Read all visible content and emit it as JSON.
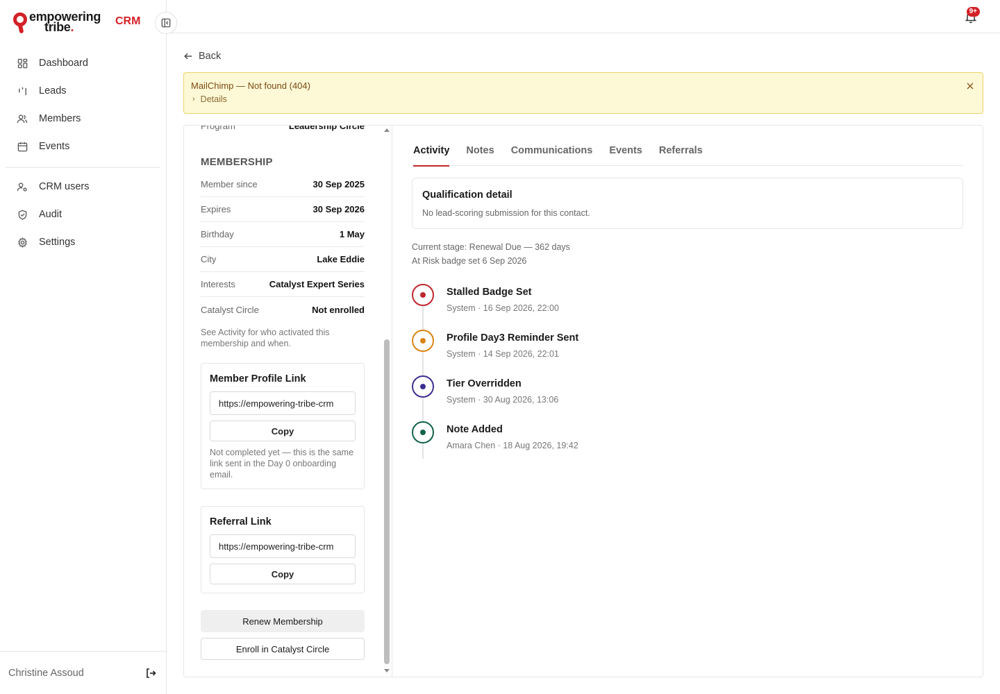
{
  "brand": {
    "line1": "empowering",
    "line2": "tribe",
    "suffix": "CRM"
  },
  "sidebar": {
    "items": [
      {
        "label": "Dashboard",
        "icon": "dashboard-icon"
      },
      {
        "label": "Leads",
        "icon": "leads-icon"
      },
      {
        "label": "Members",
        "icon": "members-icon"
      },
      {
        "label": "Events",
        "icon": "calendar-icon"
      }
    ],
    "admin_items": [
      {
        "label": "CRM users",
        "icon": "user-gear-icon"
      },
      {
        "label": "Audit",
        "icon": "shield-icon"
      },
      {
        "label": "Settings",
        "icon": "gear-icon"
      }
    ],
    "user_name": "Christine Assoud"
  },
  "topbar": {
    "notification_count": "9+"
  },
  "back_label": "Back",
  "alert": {
    "title": "MailChimp — Not found (404)",
    "details_label": "Details"
  },
  "profile": {
    "partial_row": {
      "label": "Program",
      "value": "Leadership Circle"
    },
    "membership_title": "MEMBERSHIP",
    "rows": [
      {
        "label": "Member since",
        "value": "30 Sep 2025"
      },
      {
        "label": "Expires",
        "value": "30 Sep 2026"
      },
      {
        "label": "Birthday",
        "value": "1 May"
      },
      {
        "label": "City",
        "value": "Lake Eddie"
      },
      {
        "label": "Interests",
        "value": "Catalyst Expert Series"
      },
      {
        "label": "Catalyst Circle",
        "value": "Not enrolled"
      }
    ],
    "help_text": "See Activity for who activated this membership and when.",
    "member_profile_link": {
      "title": "Member Profile Link",
      "value": "https://empowering-tribe-crm",
      "copy_label": "Copy",
      "note": "Not completed yet — this is the same link sent in the Day 0 onboarding email."
    },
    "referral_link": {
      "title": "Referral Link",
      "value": "https://empowering-tribe-crm",
      "copy_label": "Copy"
    },
    "renew_label": "Renew Membership",
    "enroll_label": "Enroll in Catalyst Circle"
  },
  "tabs": [
    {
      "label": "Activity",
      "active": true
    },
    {
      "label": "Notes",
      "active": false
    },
    {
      "label": "Communications",
      "active": false
    },
    {
      "label": "Events",
      "active": false
    },
    {
      "label": "Referrals",
      "active": false
    }
  ],
  "qualification": {
    "title": "Qualification detail",
    "text": "No lead-scoring submission for this contact."
  },
  "stage": {
    "line1": "Current stage: Renewal Due — 362 days",
    "line2": "At Risk badge set 6 Sep 2026"
  },
  "timeline": [
    {
      "title": "Stalled Badge Set",
      "meta": "System · 16 Sep 2026, 22:00",
      "color": "#c0262d"
    },
    {
      "title": "Profile Day3 Reminder Sent",
      "meta": "System · 14 Sep 2026, 22:01",
      "color": "#d98313"
    },
    {
      "title": "Tier Overridden",
      "meta": "System · 30 Aug 2026, 13:06",
      "color": "#3b2f8f"
    },
    {
      "title": "Note Added",
      "meta": "Amara Chen · 18 Aug 2026, 19:42",
      "color": "#13614a"
    }
  ]
}
